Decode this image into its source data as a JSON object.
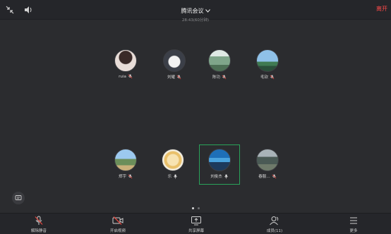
{
  "header": {
    "title": "腾讯会议",
    "duration": "28:43(60分钟)",
    "leave_label": "离开"
  },
  "participants": [
    {
      "name": "ruia",
      "mic": "muted"
    },
    {
      "name": "刘耀",
      "mic": "muted"
    },
    {
      "name": "陈功",
      "mic": "muted"
    },
    {
      "name": "毛钦",
      "mic": "muted"
    },
    {
      "name": "郑宇",
      "mic": "muted"
    },
    {
      "name": "乐",
      "mic": "on"
    },
    {
      "name": "刘俊杰",
      "mic": "on",
      "speaking": true
    },
    {
      "name": "春服…",
      "mic": "muted"
    }
  ],
  "pagination": {
    "current": 1,
    "total": 2
  },
  "toolbar": {
    "unmute_label": "解除静音",
    "video_label": "开启视频",
    "share_label": "共享屏幕",
    "members_label": "成员(11)",
    "more_label": "更多"
  },
  "icons": {
    "collapse": "collapse-arrows-icon",
    "speaker": "speaker-icon",
    "chat": "chat-icon",
    "mic_muted": "mic-muted-icon",
    "mic_on": "mic-icon",
    "video_off": "video-off-icon",
    "share": "share-screen-icon",
    "members": "members-icon",
    "more": "more-menu-icon"
  },
  "colors": {
    "background": "#2b2c2f",
    "bar": "#25262a",
    "leave": "#ff4a4a",
    "speaking_border": "#29a35a",
    "muted_red": "#e0473f"
  }
}
